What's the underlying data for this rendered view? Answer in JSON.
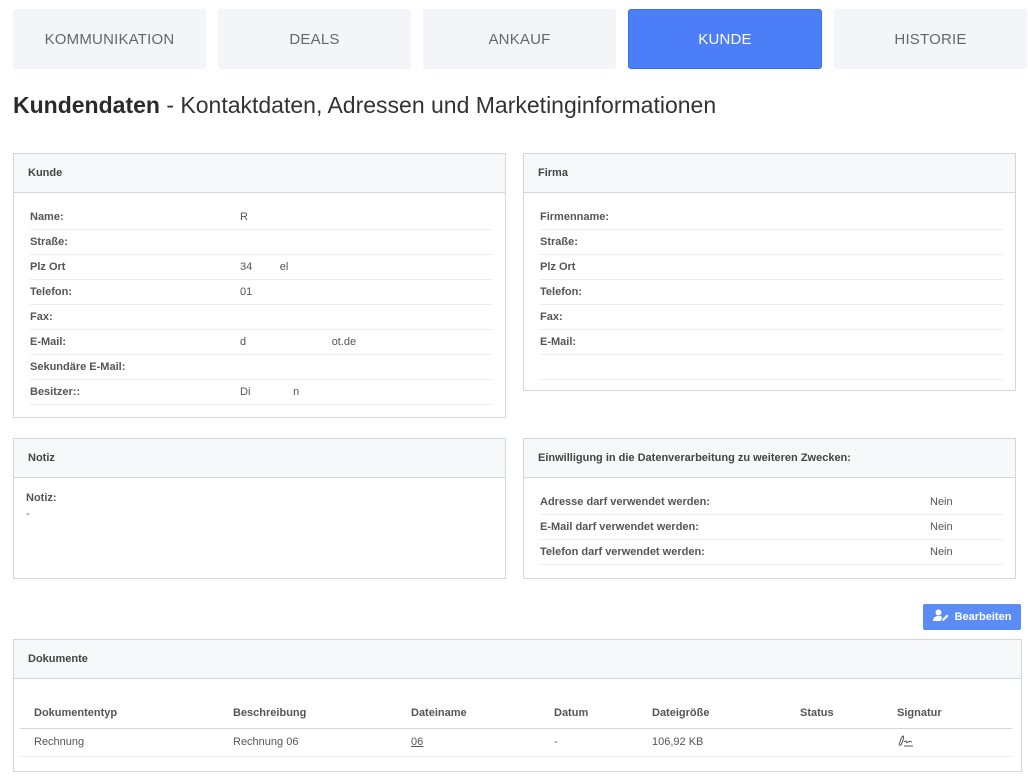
{
  "tabs": [
    {
      "label": "KOMMUNIKATION",
      "active": false
    },
    {
      "label": "DEALS",
      "active": false
    },
    {
      "label": "ANKAUF",
      "active": false
    },
    {
      "label": "KUNDE",
      "active": true
    },
    {
      "label": "HISTORIE",
      "active": false
    }
  ],
  "page": {
    "title_bold": "Kundendaten",
    "title_rest": " - Kontaktdaten, Adressen und Marketinginformationen"
  },
  "kunde": {
    "title": "Kunde",
    "rows": [
      {
        "label": "Name:",
        "value": "R"
      },
      {
        "label": "Straße:",
        "value": ""
      },
      {
        "label": "Plz Ort",
        "value": "34         el"
      },
      {
        "label": "Telefon:",
        "value": "01"
      },
      {
        "label": "Fax:",
        "value": ""
      },
      {
        "label": "E-Mail:",
        "value": "d                            ot.de"
      },
      {
        "label": "Sekundäre E-Mail:",
        "value": ""
      },
      {
        "label": "Besitzer::",
        "value": "Di              n"
      }
    ]
  },
  "firma": {
    "title": "Firma",
    "rows": [
      {
        "label": "Firmenname:"
      },
      {
        "label": "Straße:"
      },
      {
        "label": "Plz Ort"
      },
      {
        "label": "Telefon:"
      },
      {
        "label": "Fax:"
      },
      {
        "label": "E-Mail:"
      }
    ]
  },
  "notiz": {
    "title": "Notiz",
    "label": "Notiz:",
    "value": "-"
  },
  "consent": {
    "title": "Einwilligung in die Datenverarbeitung zu weiteren Zwecken:",
    "rows": [
      {
        "label": "Adresse darf verwendet werden:",
        "value": "Nein"
      },
      {
        "label": "E-Mail darf verwendet werden:",
        "value": "Nein"
      },
      {
        "label": "Telefon darf verwendet werden:",
        "value": "Nein"
      }
    ]
  },
  "edit_button": {
    "label": "Bearbeiten",
    "icon": "user-edit-icon",
    "color": "#5b8cf6"
  },
  "dokumente": {
    "title": "Dokumente",
    "columns": [
      "Dokumententyp",
      "Beschreibung",
      "Dateiname",
      "Datum",
      "Dateigröße",
      "Status",
      "Signatur"
    ],
    "rows": [
      {
        "typ": "Rechnung",
        "beschreibung": "Rechnung 06",
        "dateiname": "06",
        "datum": "-",
        "groesse": "106,92 KB",
        "status": "",
        "signatur_icon": "signature-icon"
      }
    ]
  },
  "colors": {
    "accent": "#4c7ef8",
    "panel_head": "#f7f8fa",
    "border": "#d4d6dc"
  }
}
